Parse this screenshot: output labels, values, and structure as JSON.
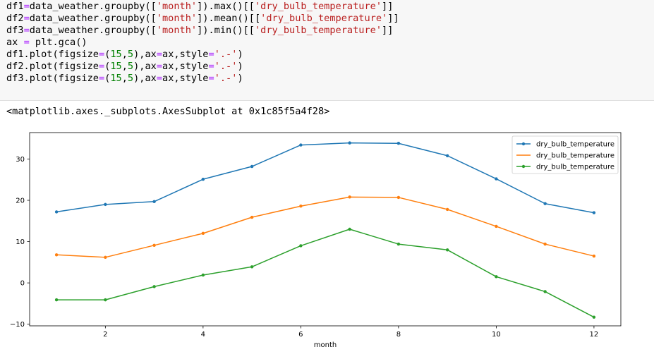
{
  "code": {
    "lines": [
      [
        {
          "t": "df1"
        },
        {
          "t": "=",
          "c": "op"
        },
        {
          "t": "data_weather.groupby(["
        },
        {
          "t": "'month'",
          "c": "str"
        },
        {
          "t": "]).max()[["
        },
        {
          "t": "'dry_bulb_temperature'",
          "c": "str"
        },
        {
          "t": "]]"
        }
      ],
      [
        {
          "t": "df2"
        },
        {
          "t": "=",
          "c": "op"
        },
        {
          "t": "data_weather.groupby(["
        },
        {
          "t": "'month'",
          "c": "str"
        },
        {
          "t": "]).mean()[["
        },
        {
          "t": "'dry_bulb_temperature'",
          "c": "str"
        },
        {
          "t": "]]"
        }
      ],
      [
        {
          "t": "df3"
        },
        {
          "t": "=",
          "c": "op"
        },
        {
          "t": "data_weather.groupby(["
        },
        {
          "t": "'month'",
          "c": "str"
        },
        {
          "t": "]).min()[["
        },
        {
          "t": "'dry_bulb_temperature'",
          "c": "str"
        },
        {
          "t": "]]"
        }
      ],
      [
        {
          "t": "ax "
        },
        {
          "t": "=",
          "c": "op"
        },
        {
          "t": " plt.gca()"
        }
      ],
      [
        {
          "t": "df1.plot(figsize"
        },
        {
          "t": "=",
          "c": "op"
        },
        {
          "t": "("
        },
        {
          "t": "15",
          "c": "num"
        },
        {
          "t": ","
        },
        {
          "t": "5",
          "c": "num"
        },
        {
          "t": "),ax"
        },
        {
          "t": "=",
          "c": "op"
        },
        {
          "t": "ax,style"
        },
        {
          "t": "=",
          "c": "op"
        },
        {
          "t": "'.-'",
          "c": "str"
        },
        {
          "t": ")"
        }
      ],
      [
        {
          "t": "df2.plot(figsize"
        },
        {
          "t": "=",
          "c": "op"
        },
        {
          "t": "("
        },
        {
          "t": "15",
          "c": "num"
        },
        {
          "t": ","
        },
        {
          "t": "5",
          "c": "num"
        },
        {
          "t": "),ax"
        },
        {
          "t": "=",
          "c": "op"
        },
        {
          "t": "ax,style"
        },
        {
          "t": "=",
          "c": "op"
        },
        {
          "t": "'.-'",
          "c": "str"
        },
        {
          "t": ")"
        }
      ],
      [
        {
          "t": "df3.plot(figsize"
        },
        {
          "t": "=",
          "c": "op"
        },
        {
          "t": "("
        },
        {
          "t": "15",
          "c": "num"
        },
        {
          "t": ","
        },
        {
          "t": "5",
          "c": "num"
        },
        {
          "t": "),ax"
        },
        {
          "t": "=",
          "c": "op"
        },
        {
          "t": "ax,style"
        },
        {
          "t": "=",
          "c": "op"
        },
        {
          "t": "'.-'",
          "c": "str"
        },
        {
          "t": ")"
        }
      ]
    ]
  },
  "output": {
    "repr": "<matplotlib.axes._subplots.AxesSubplot at 0x1c85f5a4f28>"
  },
  "chart_data": {
    "type": "line",
    "x": [
      1,
      2,
      3,
      4,
      5,
      6,
      7,
      8,
      9,
      10,
      11,
      12
    ],
    "xticks": [
      2,
      4,
      6,
      8,
      10,
      12
    ],
    "yticks": [
      -10,
      0,
      10,
      20,
      30
    ],
    "xlim": [
      0.45,
      12.55
    ],
    "ylim": [
      -10.4,
      36.4
    ],
    "xlabel": "month",
    "ylabel": "",
    "legend_position": "top-right",
    "grid": false,
    "series": [
      {
        "name": "dry_bulb_temperature",
        "color": "#1f77b4",
        "marker": ".",
        "values": [
          17.2,
          19.0,
          19.7,
          25.1,
          28.2,
          33.4,
          33.9,
          33.8,
          30.8,
          25.2,
          19.2,
          17.0
        ]
      },
      {
        "name": "dry_bulb_temperature",
        "color": "#ff7f0e",
        "marker": "none",
        "values": [
          6.8,
          6.2,
          9.1,
          12.0,
          15.9,
          18.6,
          20.8,
          20.7,
          17.8,
          13.7,
          9.4,
          6.5
        ]
      },
      {
        "name": "dry_bulb_temperature",
        "color": "#2ca02c",
        "marker": ".",
        "values": [
          -4.1,
          -4.1,
          -0.9,
          1.9,
          3.9,
          9.0,
          13.0,
          9.4,
          8.0,
          1.5,
          -2.1,
          -8.3
        ]
      }
    ]
  }
}
